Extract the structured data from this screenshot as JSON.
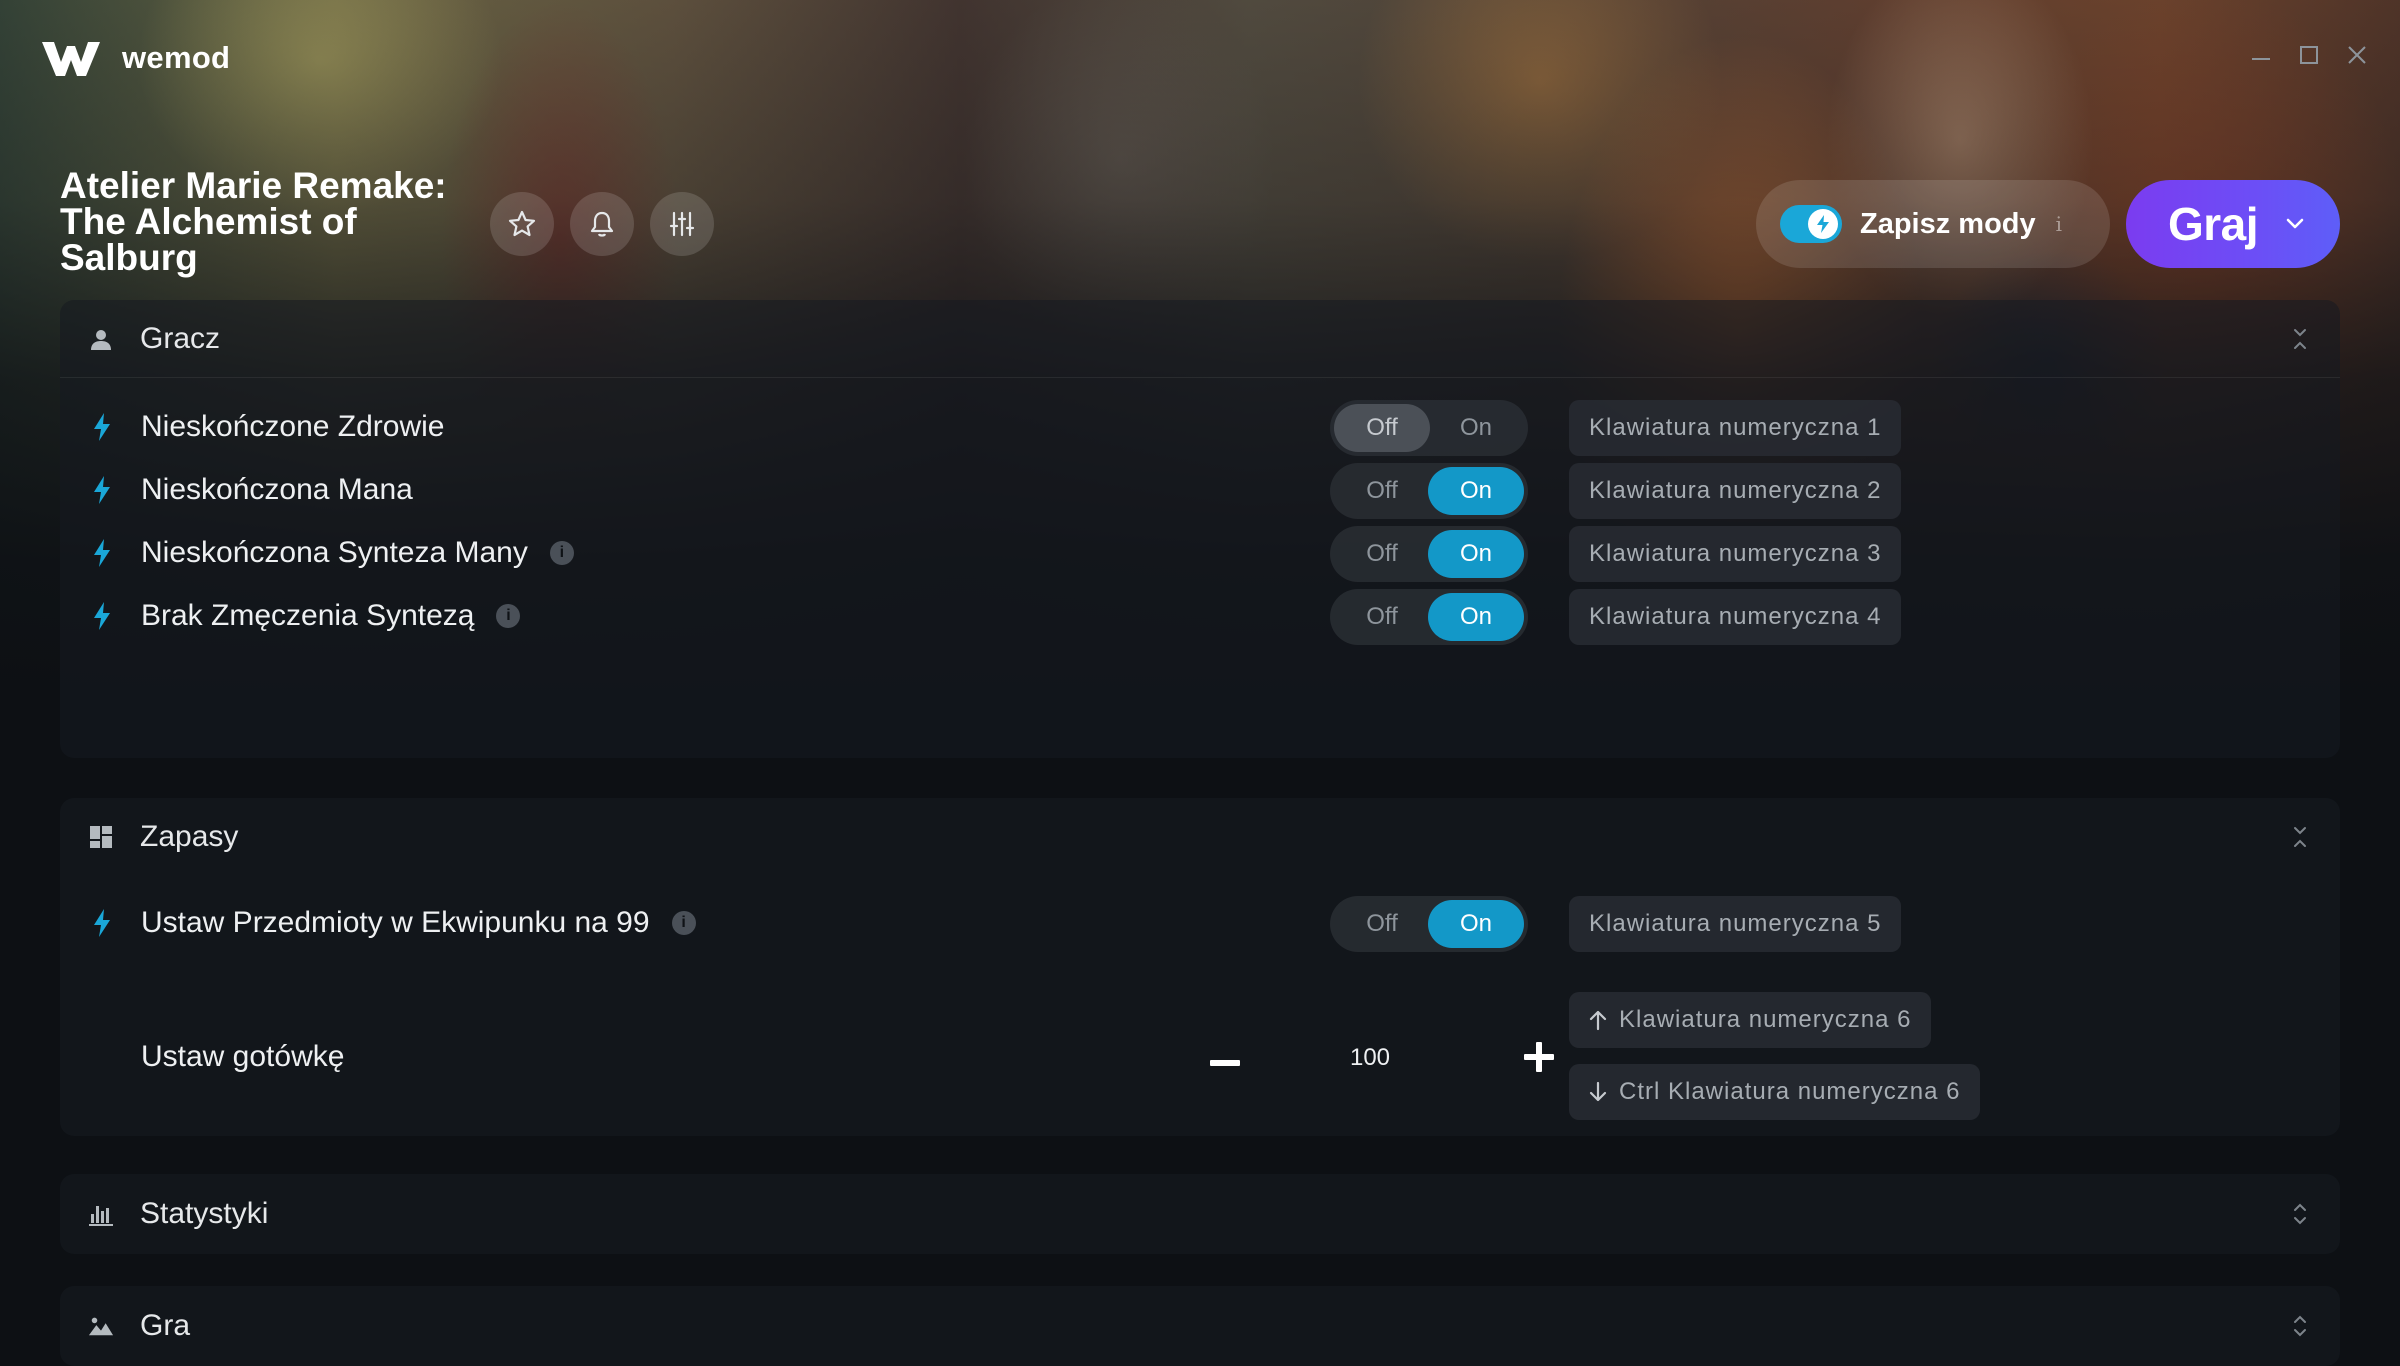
{
  "app": {
    "name": "wemod"
  },
  "game": {
    "title_line1": "Atelier Marie Remake:",
    "title_line2": "The Alchemist of",
    "title_line3": "Salburg"
  },
  "header": {
    "save_mods_label": "Zapisz mody",
    "save_mods_enabled": true,
    "info_glyph": "i",
    "play_label": "Graj"
  },
  "sections": {
    "gracz": {
      "title": "Gracz",
      "mods": [
        {
          "name": "Nieskończone Zdrowie",
          "state": "off",
          "hotkey": "Klawiatura numeryczna 1",
          "info": false
        },
        {
          "name": "Nieskończona Mana",
          "state": "on",
          "hotkey": "Klawiatura numeryczna 2",
          "info": false
        },
        {
          "name": "Nieskończona Synteza Many",
          "state": "on",
          "hotkey": "Klawiatura numeryczna 3",
          "info": true
        },
        {
          "name": "Brak Zmęczenia Syntezą",
          "state": "on",
          "hotkey": "Klawiatura numeryczna 4",
          "info": true
        }
      ]
    },
    "zapasy": {
      "title": "Zapasy",
      "mods": [
        {
          "name": "Ustaw Przedmioty w Ekwipunku na 99",
          "state": "on",
          "hotkey": "Klawiatura numeryczna 5",
          "info": true
        }
      ],
      "cash": {
        "name": "Ustaw gotówkę",
        "value": "100",
        "hotkey_up": "Klawiatura numeryczna 6",
        "hotkey_down": "Ctrl Klawiatura numeryczna 6"
      }
    },
    "statystyki": {
      "title": "Statystyki"
    },
    "gra": {
      "title": "Gra"
    }
  },
  "toggle_labels": {
    "off": "Off",
    "on": "On"
  },
  "info_badge": "i",
  "colors": {
    "accent": "#1398c8",
    "play_gradient_start": "#7b3cf0",
    "play_gradient_end": "#5e5ef8",
    "background": "#0d1014"
  },
  "icons": {
    "logo": "wemod-w-logo",
    "favorite": "star-icon",
    "notifications": "bell-icon",
    "settings": "sliders-icon",
    "mod": "bolt-icon",
    "gracz": "user-icon",
    "zapasy": "grid-icon",
    "statystyki": "bar-chart-icon",
    "gra": "landscape-icon"
  }
}
